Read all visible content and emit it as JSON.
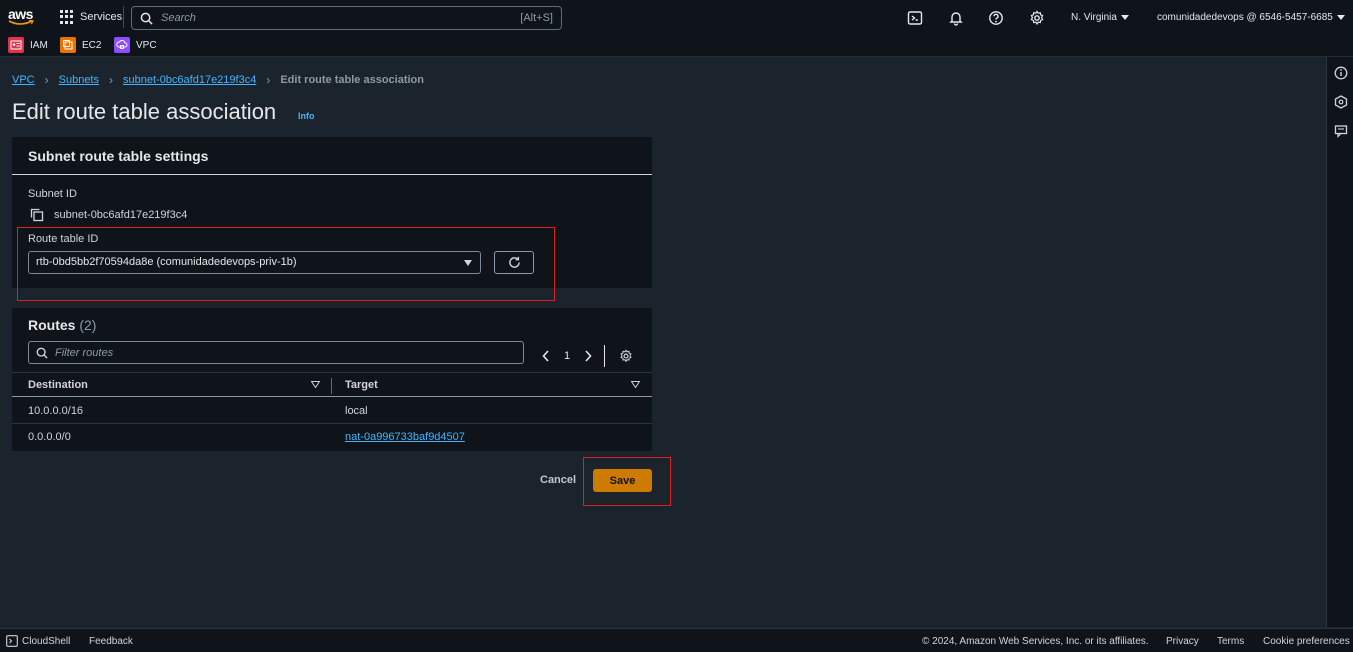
{
  "topbar": {
    "logo_text": "aws",
    "services_label": "Services",
    "search_placeholder": "Search",
    "search_shortcut": "[Alt+S]",
    "region": "N. Virginia",
    "account": "comunidadedevops @ 6546-5457-6685",
    "icons": [
      "cloudshell-icon",
      "bell-icon",
      "help-icon",
      "settings-icon"
    ]
  },
  "favorites": [
    {
      "label": "IAM",
      "color": "#dd344c"
    },
    {
      "label": "EC2",
      "color": "#ed7100"
    },
    {
      "label": "VPC",
      "color": "#8c4fff"
    }
  ],
  "breadcrumb": {
    "items": [
      "VPC",
      "Subnets",
      "subnet-0bc6afd17e219f3c4"
    ],
    "current": "Edit route table association"
  },
  "page": {
    "title": "Edit route table association",
    "info": "Info"
  },
  "settings": {
    "header": "Subnet route table settings",
    "subnet_id_label": "Subnet ID",
    "subnet_id_value": "subnet-0bc6afd17e219f3c4",
    "route_table_label": "Route table ID",
    "route_table_value": "rtb-0bd5bb2f70594da8e (comunidadedevops-priv-1b)"
  },
  "routes": {
    "title": "Routes",
    "count": "(2)",
    "filter_placeholder": "Filter routes",
    "page": "1",
    "columns": [
      "Destination",
      "Target"
    ],
    "rows": [
      {
        "destination": "10.0.0.0/16",
        "target": "local"
      },
      {
        "destination": "0.0.0.0/0",
        "target": "nat-0a996733baf9d4507"
      }
    ]
  },
  "actions": {
    "cancel": "Cancel",
    "save": "Save"
  },
  "footer": {
    "cloudshell": "CloudShell",
    "feedback": "Feedback",
    "copyright": "© 2024, Amazon Web Services, Inc. or its affiliates.",
    "privacy": "Privacy",
    "terms": "Terms",
    "cookies": "Cookie preferences"
  },
  "colors": {
    "accent_link": "#42b4ff",
    "primary_button": "#cc7a00",
    "highlight_box": "#e01e1e"
  }
}
